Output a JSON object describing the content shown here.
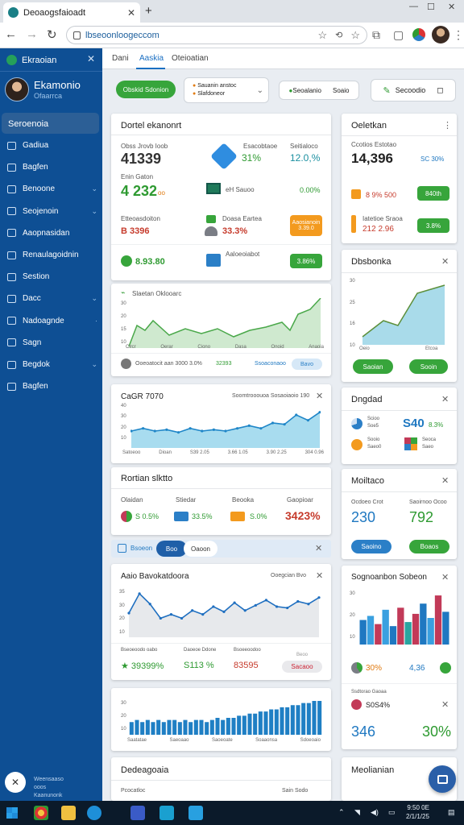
{
  "browser": {
    "tab_title": "Deoaogsfaioadt",
    "url": "lbseoonloogeccom",
    "new_tab": "+"
  },
  "sidebar": {
    "brand": "Ekraoian",
    "profile_name": "Ekamonio",
    "profile_sub": "Ofaarrca",
    "active_item": "Seroenoia",
    "items": [
      {
        "label": "Gadiua",
        "chev": ""
      },
      {
        "label": "Bagfen",
        "chev": ""
      },
      {
        "label": "Benoone",
        "chev": "⌄"
      },
      {
        "label": "Seojenoin",
        "chev": "⌄"
      },
      {
        "label": "Aaopnasidan",
        "chev": ""
      },
      {
        "label": "Renaulagoidnin",
        "chev": ""
      },
      {
        "label": "Sestion",
        "chev": ""
      },
      {
        "label": "Dacc",
        "chev": "⌄"
      },
      {
        "label": "Nadoagnde",
        "chev": "·"
      },
      {
        "label": "Sagn",
        "chev": ""
      },
      {
        "label": "Begdok",
        "chev": "⌄"
      },
      {
        "label": "Bagfen",
        "chev": ""
      }
    ],
    "footer_line1": "Weensaaso ooos",
    "footer_line2": "Kaanunonk"
  },
  "content_tabs": [
    "Dani",
    "Aaskia",
    "Oteioatian"
  ],
  "topbar": {
    "primary_button": "Obskid Sdonion",
    "dropdown_line1": "Sauanin anstoc",
    "dropdown_line2": "Slafdoneor",
    "chip_label": "Seoalanio",
    "chip_value": "Soaio",
    "right_button": "Secoodio"
  },
  "overview_card": {
    "title": "Dortel ekanonrt",
    "rows": [
      {
        "label": "Obss Jrovb  Ioob",
        "value": "41339",
        "icon_label": "Esacobtaoe",
        "icon_value": "31%",
        "side_label": "Seitialoco",
        "side_value": "12.0,%"
      },
      {
        "label": "Enin Gaton",
        "value": "4 232",
        "suffix": "oo",
        "icon_label": "eH Sauoo",
        "side_value": "0.00%"
      },
      {
        "label": "Etteoasdoiton",
        "value": "B 3396",
        "icon_label": "Doasa Eartea",
        "icon_value": "33.3%",
        "side_label": "Aaosianoin",
        "side_value": "3.39.0"
      },
      {
        "label": "",
        "value": "8.93.80",
        "icon_label": "Aaloeoiabot",
        "side_value": "3.86%"
      }
    ]
  },
  "side_card_1": {
    "title": "Oeletkan",
    "label": "Ccotios Estotao",
    "value": "14,396",
    "side_value": "SC 30%",
    "row2_value": "8 9% 500",
    "row2_badge": "840th",
    "row3_label": "Iatetioe Sraoa",
    "row3_value": "212 2.96",
    "row3_badge": "3.8%"
  },
  "line_card_1": {
    "title": "Slaetan Oklooarc",
    "y_ticks": [
      "30",
      "20",
      "15",
      "10"
    ],
    "x_ticks": [
      "Clrcr",
      "Oerar",
      "Ciono",
      "Dasa",
      "Onoid",
      "Anaoia"
    ],
    "foot_label": "Ooeoatocit aan 3000 3.0%",
    "foot_value": "32393",
    "foot_link": "Ssoaconaoo",
    "foot_chip": "Bavo"
  },
  "side_card_2": {
    "title": "Dbsbonka",
    "y_ticks": [
      "30",
      "25",
      "16",
      "10"
    ],
    "x_ticks": [
      "Oeio",
      "Etcoa"
    ],
    "btn1": "Saoian",
    "btn2": "Sooin"
  },
  "area_card": {
    "title": "CaGR 7070",
    "subtitle": "Soomtrooouoa  Sosaoiaoio 190",
    "y_ticks": [
      "40",
      "30",
      "20",
      "10"
    ],
    "x_ticks": [
      "Satoeoo",
      "Dioan",
      "S39 2.05",
      "3.66 1.05",
      "3.90 2.25",
      "304 0.96"
    ],
    "series": [
      12,
      14,
      12,
      13,
      11,
      14,
      12,
      13,
      12,
      14,
      16,
      14,
      18,
      17,
      24,
      20,
      26
    ]
  },
  "side_card_3": {
    "title": "Dngdad",
    "r1_label": "Scioo",
    "r1_sub": "Soe5",
    "r1_value": "S40",
    "r1_pct": "8.3%",
    "r2_label": "Sooio",
    "r2_sub": "Saeo0",
    "r2_right": "Seoca",
    "r2_right_sub": "Saeo"
  },
  "summary_card": {
    "title": "Rortian slktto",
    "items": [
      {
        "label": "Olaidan",
        "value": "S 0.5%"
      },
      {
        "label": "Stiedar",
        "value": "33.5%"
      },
      {
        "label": "Beooka",
        "value": "S.0%"
      },
      {
        "label": "Gaopioar",
        "value": "3423%"
      }
    ]
  },
  "side_card_4": {
    "title": "Moiltaco",
    "labels": [
      "Ocdoeo Crot",
      "Saoirnoo Ocoo"
    ],
    "values": [
      "230",
      "792"
    ],
    "btn1": "Saoino",
    "btn2": "Boaos"
  },
  "filter_bar": {
    "label": "Bsoeon",
    "chip1": "Boo",
    "chip2": "Oaoon"
  },
  "line_card_2": {
    "title": "Aaio Bavokatdoora",
    "subtitle": "Ooegcian Bvo",
    "y_ticks": [
      "35",
      "30",
      "20",
      "10"
    ],
    "series": [
      18,
      33,
      25,
      14,
      17,
      14,
      20,
      17,
      23,
      19,
      26,
      20,
      24,
      28,
      23,
      22,
      27,
      25,
      30
    ],
    "foot": [
      {
        "label": "Bseoeoodo oabo",
        "value": "★ 39399%"
      },
      {
        "label": "Daoeoe Ddone",
        "value": "S113 %"
      },
      {
        "label": "Bsoeeoodoo",
        "value": "83595"
      },
      {
        "label": "Beoo",
        "value": "Sacaoo"
      }
    ]
  },
  "side_card_5": {
    "title": "Sognoanbon Sobeon",
    "y_ticks": [
      "30",
      "20",
      "10"
    ],
    "bars": [
      12,
      14,
      10,
      17,
      9,
      18,
      11,
      15,
      20,
      13,
      24,
      16
    ],
    "bar_colors": [
      "#1f78c1",
      "#3aa0e0",
      "#c23a58",
      "#3aa0e0",
      "#1f78c1",
      "#c23a58",
      "#2aa5a0",
      "#c23a58",
      "#1f78c1",
      "#3aa0e0",
      "#c23a58",
      "#1f78c1"
    ],
    "foot_left": "30%",
    "foot_right": "4,36",
    "row_label": "Ssdtorao Gaoaa",
    "row_value": "S0S4%",
    "big_left": "346",
    "big_right": "30%"
  },
  "histogram_card": {
    "y_ticks": [
      "30",
      "20",
      "10"
    ],
    "bars": [
      6,
      7,
      6,
      7,
      6,
      7,
      6,
      7,
      7,
      6,
      7,
      6,
      7,
      7,
      6,
      7,
      8,
      7,
      8,
      8,
      9,
      9,
      10,
      10,
      11,
      11,
      12,
      12,
      13,
      13,
      14,
      14,
      15,
      15,
      16,
      16
    ],
    "x_ticks": [
      "Saatatae",
      "Saeoaao",
      "Saoeoate",
      "Soaaonsa",
      "Sdoeoaio"
    ]
  },
  "bottom_left_card": {
    "title": "Dedeagoaia",
    "row_label": "Pcocatloc",
    "row_right": "Sain Sodo"
  },
  "bottom_right_card": {
    "title": "Meolianian"
  },
  "taskbar": {
    "time": "9:50 0E",
    "date": "2/1/1/25"
  }
}
